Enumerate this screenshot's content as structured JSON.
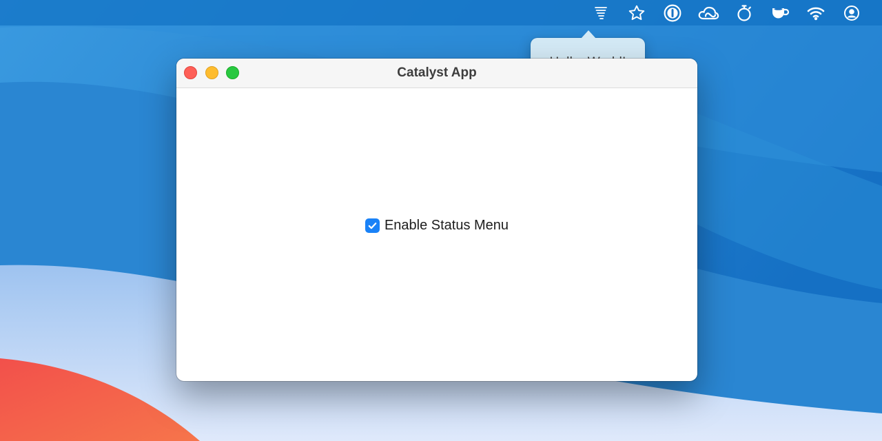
{
  "menubar": {
    "icons": [
      "tornado-icon",
      "star-icon",
      "onepassword-icon",
      "creative-cloud-icon",
      "stopwatch-icon",
      "coffee-cup-icon",
      "wifi-icon",
      "user-circle-icon"
    ]
  },
  "popover": {
    "text": "Hello, World!"
  },
  "window": {
    "title": "Catalyst App",
    "checkbox": {
      "label": "Enable Status Menu",
      "checked": true
    }
  },
  "colors": {
    "accent": "#1a82f7",
    "close": "#fe5f57",
    "minimize": "#febc2e",
    "maximize": "#28c840",
    "popover_bg": "#d4eaf6"
  }
}
